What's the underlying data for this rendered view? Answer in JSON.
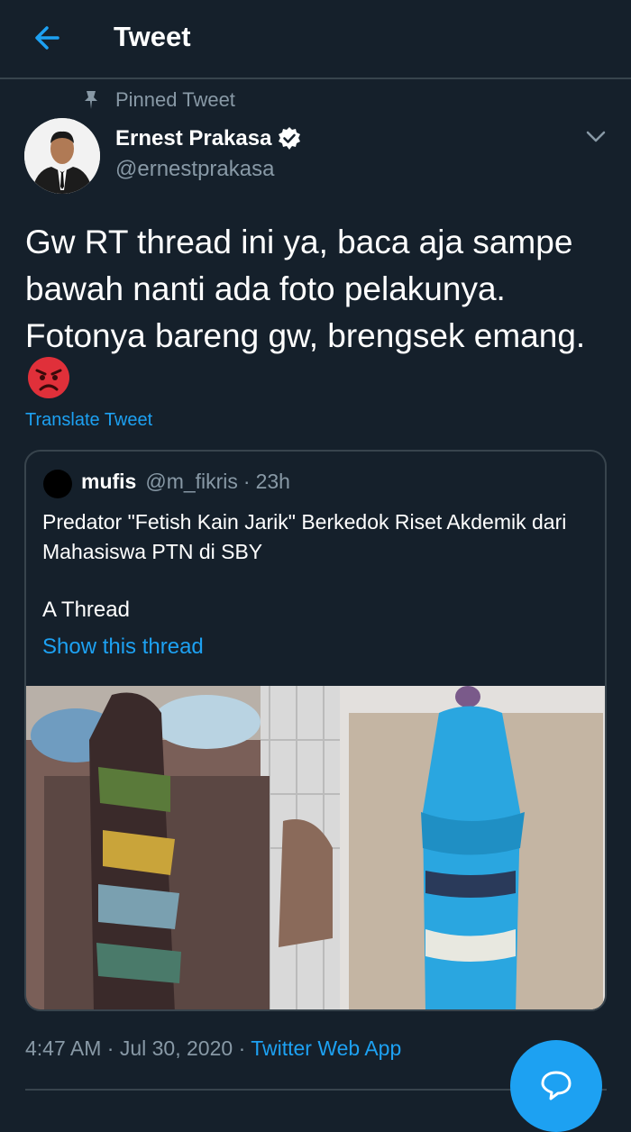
{
  "header": {
    "title": "Tweet"
  },
  "pinned": {
    "label": "Pinned Tweet"
  },
  "user": {
    "name": "Ernest Prakasa",
    "handle": "@ernestprakasa"
  },
  "tweet": {
    "text": "Gw RT thread ini ya, baca aja sampe bawah nanti ada foto pelakunya. Fotonya bareng gw, brengsek emang.",
    "translate_label": "Translate Tweet"
  },
  "quote": {
    "name": "mufis",
    "handle": "@m_fikris",
    "time": "23h",
    "text": "Predator \"Fetish Kain Jarik\" Berkedok Riset Akdemik dari Mahasiswa PTN di SBY",
    "thread_label": "A Thread",
    "show_thread": "Show this thread"
  },
  "meta": {
    "time": "4:47 AM",
    "date": "Jul 30, 2020",
    "app": "Twitter Web App"
  },
  "colors": {
    "accent": "#1da1f2",
    "background": "#15202b",
    "muted": "#8899a6",
    "border": "#38444d"
  }
}
